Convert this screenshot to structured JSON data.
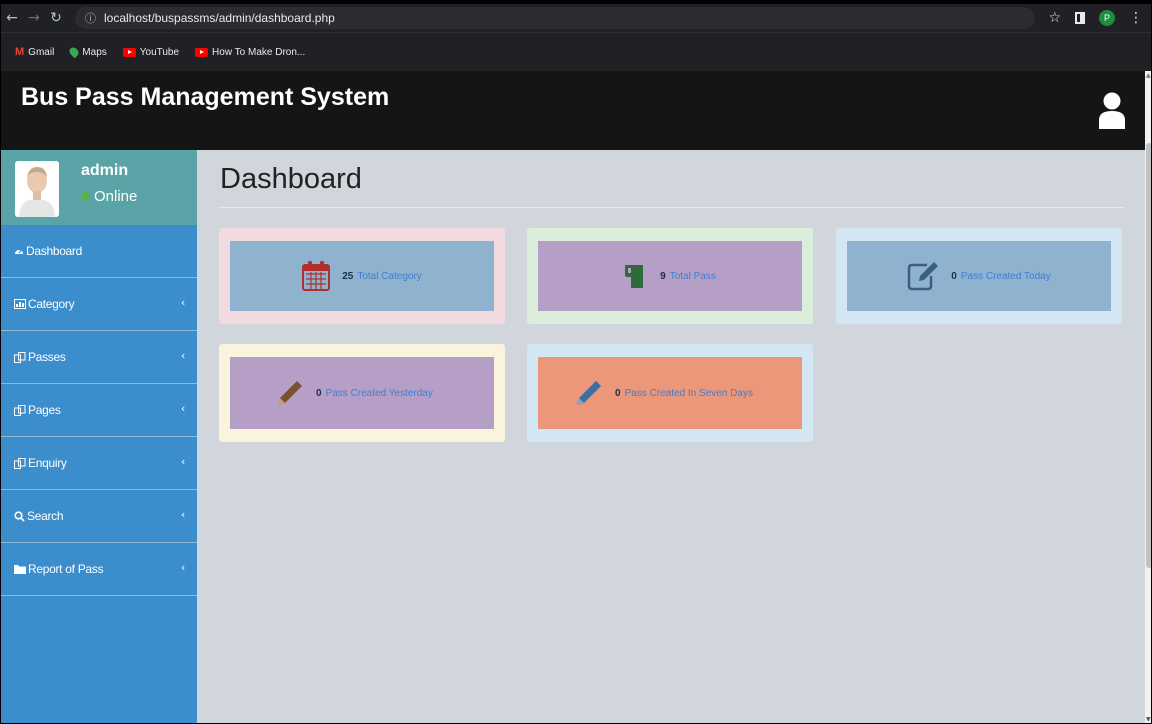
{
  "browser": {
    "url": "localhost/buspassms/admin/dashboard.php",
    "profile_initial": "P",
    "bookmarks": [
      {
        "label": "Gmail"
      },
      {
        "label": "Maps"
      },
      {
        "label": "YouTube"
      },
      {
        "label": "How To Make Dron..."
      }
    ]
  },
  "header": {
    "title": "Bus Pass Management System"
  },
  "sidebar": {
    "user": {
      "name": "admin",
      "status": "Online"
    },
    "items": [
      {
        "label": "Dashboard",
        "icon": "dashboard-icon",
        "has_submenu": false
      },
      {
        "label": "Category",
        "icon": "table-icon",
        "has_submenu": true
      },
      {
        "label": "Passes",
        "icon": "copy-icon",
        "has_submenu": true
      },
      {
        "label": "Pages",
        "icon": "copy-icon",
        "has_submenu": true
      },
      {
        "label": "Enquiry",
        "icon": "copy-icon",
        "has_submenu": true
      },
      {
        "label": "Search",
        "icon": "search-icon",
        "has_submenu": true
      },
      {
        "label": "Report of Pass",
        "icon": "folder-icon",
        "has_submenu": true
      }
    ]
  },
  "main": {
    "page_title": "Dashboard",
    "cards": [
      {
        "count": "25",
        "label": "Total Category",
        "icon": "calendar-icon",
        "outer_color": "#f1dbe0",
        "inner_color": "#8fb2cf",
        "icon_color": "#b0302e"
      },
      {
        "count": "9",
        "label": "Total Pass",
        "icon": "mug-icon",
        "outer_color": "#dbeedb",
        "inner_color": "#b59fc6",
        "icon_color": "#2f6b38"
      },
      {
        "count": "0",
        "label": "Pass Created Today",
        "icon": "edit-icon",
        "outer_color": "#d3e6f3",
        "inner_color": "#8fb2cf",
        "icon_color": "#3a5f80"
      },
      {
        "count": "0",
        "label": "Pass Created Yesterday",
        "icon": "pencil-icon",
        "outer_color": "#fbf4dc",
        "inner_color": "#b59fc6",
        "icon_color": "#7a5230"
      },
      {
        "count": "0",
        "label": "Pass Created In Seven Days",
        "icon": "pencil-icon",
        "outer_color": "#d3e6f3",
        "inner_color": "#ec977a",
        "icon_color": "#3a6fa0"
      }
    ]
  }
}
